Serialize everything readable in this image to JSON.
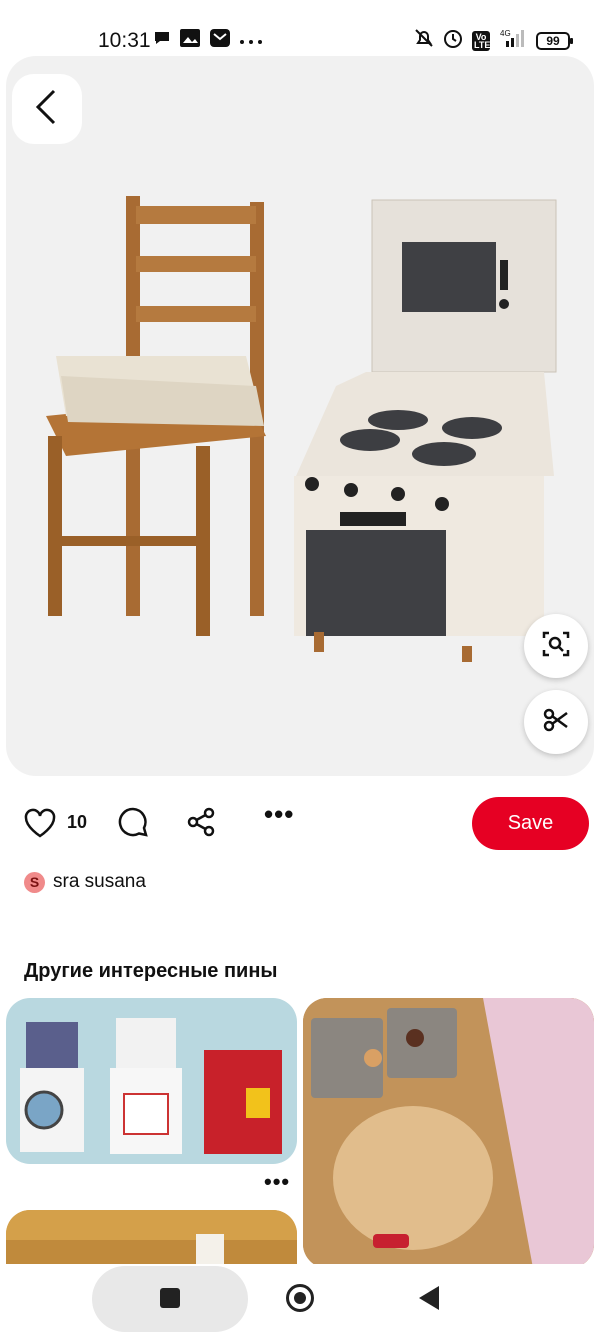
{
  "status_bar": {
    "time": "10:31",
    "network": "4G",
    "lte_label": "Vo LTE",
    "battery": "99",
    "icons": [
      "chat-bubble-icon",
      "image-icon",
      "mail-icon",
      "more-dots-icon",
      "mute-bell-icon",
      "alarm-icon",
      "signal-icon",
      "battery-icon"
    ]
  },
  "pin": {
    "like_count": "10",
    "more": "•••",
    "save_label": "Save",
    "author_initial": "S",
    "author_name": "sra susana",
    "icons": [
      "back-icon",
      "visual-search-icon",
      "scissors-icon",
      "heart-icon",
      "comment-icon",
      "share-icon"
    ]
  },
  "related": {
    "title": "Другие интересные пины",
    "more": "•••"
  },
  "colors": {
    "save_button": "#e60023",
    "hero_bg": "#f1f1f1",
    "avatar_bg": "#f08a8a"
  },
  "navigation": {
    "icons": [
      "recents-icon",
      "home-icon",
      "back-triangle-icon"
    ]
  }
}
